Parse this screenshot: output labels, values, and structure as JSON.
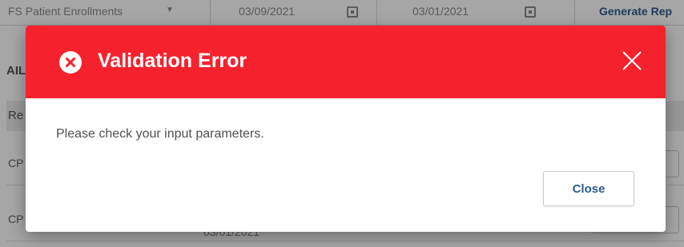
{
  "background": {
    "report_select": "FS Patient Enrollments",
    "start_date": "03/09/2021",
    "end_date": "03/01/2021",
    "generate_button": "Generate Rep",
    "section_title": "AIL",
    "table_header": "Re",
    "rows": [
      {
        "text": "CP"
      },
      {
        "text": "CP"
      }
    ],
    "row_date": "03/01/2021"
  },
  "dialog": {
    "title": "Validation Error",
    "message": "Please check your input parameters.",
    "close_button_label": "Close",
    "header_color": "#f5222d",
    "icons": {
      "status": "error-circle-x",
      "dismiss": "close-x"
    }
  }
}
